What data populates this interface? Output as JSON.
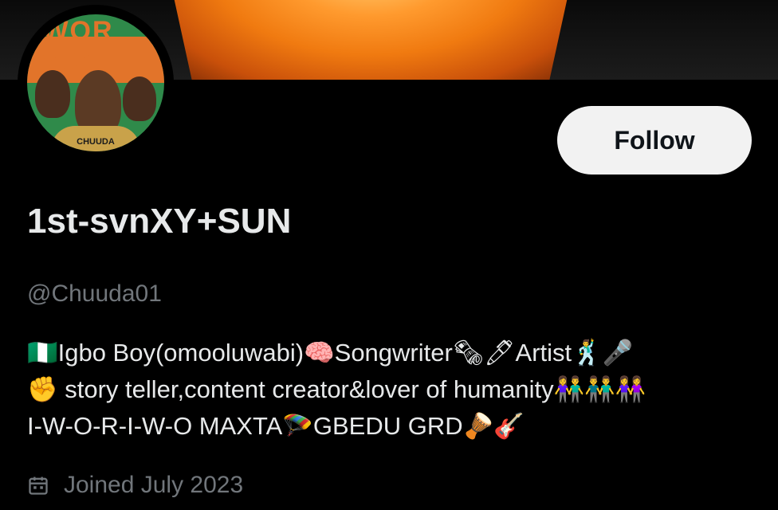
{
  "profile": {
    "display_name": "1st-svnXY+SUN",
    "handle": "@Chuuda01",
    "follow_label": "Follow",
    "joined": "Joined July 2023",
    "bio": {
      "line1": "🇳🇬Igbo Boy(omooluwabi)🧠Songwriter🗞🖊Artist🕺🎤",
      "line2": "✊ story teller,content creator&lover of humanity👫👬👭",
      "line3": "I-W-O-R-I-W-O MAXTA🪂GBEDU GRD🪘🎸"
    }
  },
  "avatar_art": {
    "title": "IWOR IWO",
    "credit": "CHUUDA"
  },
  "icons": {
    "calendar": "calendar-icon",
    "headphones": "headphones-icon"
  },
  "colors": {
    "background": "#000000",
    "follow_button_bg": "#f2f2f2",
    "secondary_text": "#71767b",
    "primary_text": "#e7e9ea"
  }
}
